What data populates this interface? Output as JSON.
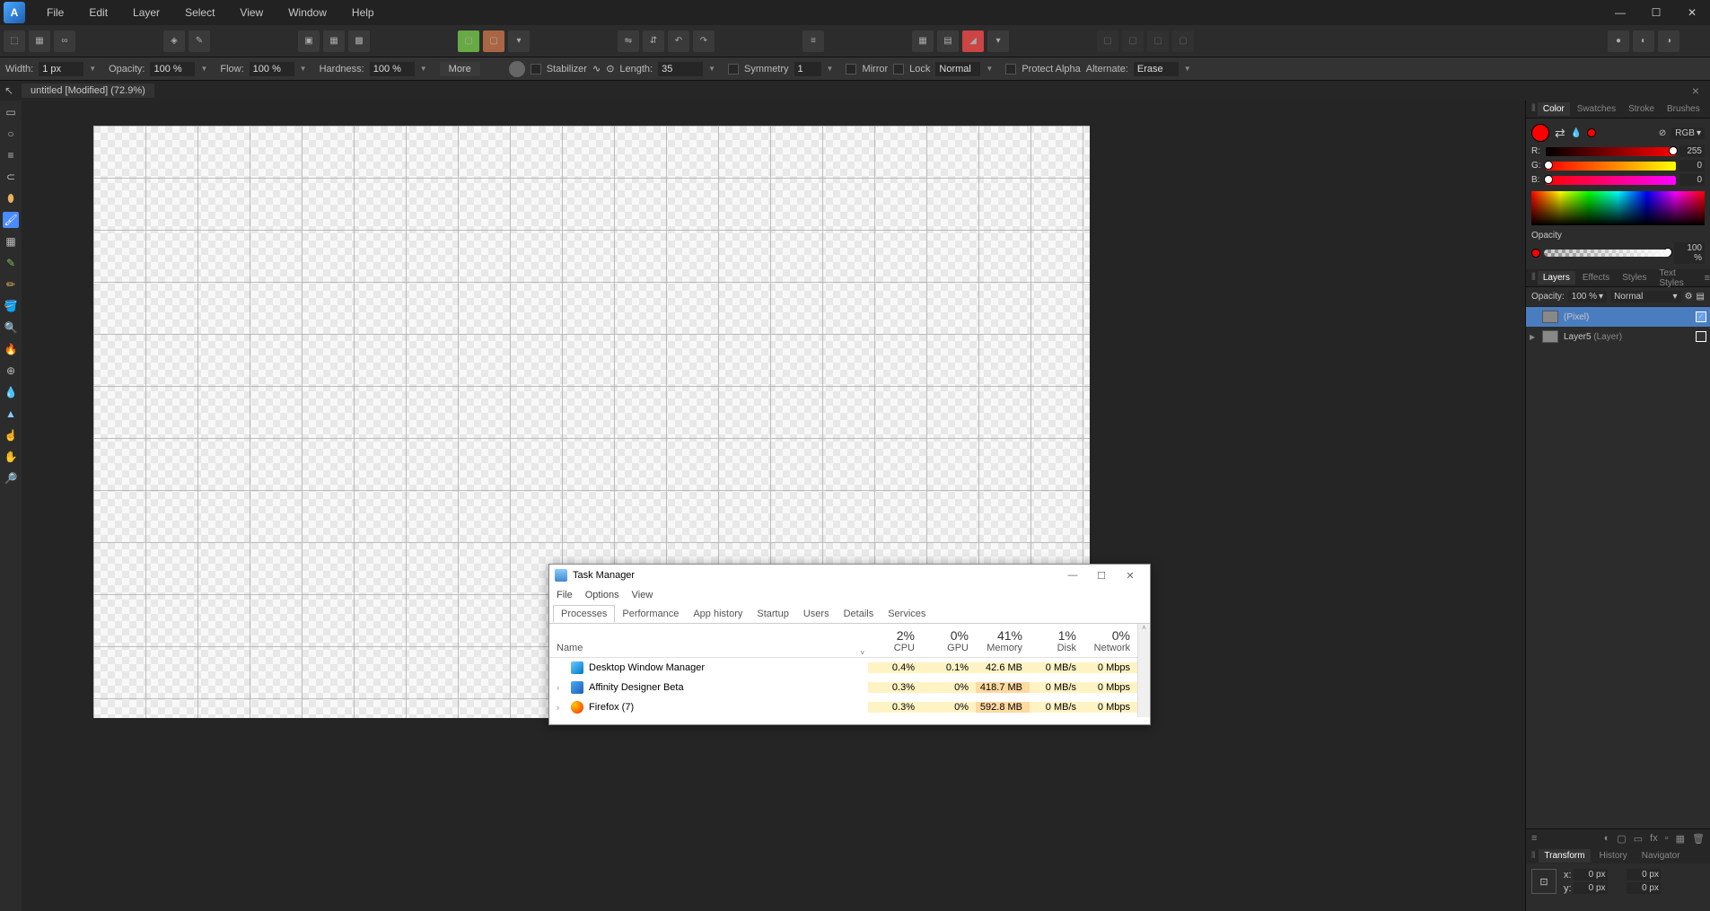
{
  "menu": {
    "items": [
      "File",
      "Edit",
      "Layer",
      "Select",
      "View",
      "Window",
      "Help"
    ]
  },
  "doc": {
    "title": "untitled [Modified] (72.9%)"
  },
  "context": {
    "width_label": "Width:",
    "width_val": "1 px",
    "opacity_label": "Opacity:",
    "opacity_val": "100 %",
    "flow_label": "Flow:",
    "flow_val": "100 %",
    "hardness_label": "Hardness:",
    "hardness_val": "100 %",
    "more": "More",
    "stabilizer": "Stabilizer",
    "length_label": "Length:",
    "length_val": "35",
    "symmetry": "Symmetry",
    "symmetry_val": "1",
    "mirror": "Mirror",
    "lock": "Lock",
    "blend": "Normal",
    "protect": "Protect Alpha",
    "alternate": "Alternate:",
    "alternate_val": "Erase"
  },
  "colorPanel": {
    "tabs": [
      "Color",
      "Swatches",
      "Stroke",
      "Brushes"
    ],
    "mode": "RGB",
    "r": {
      "label": "R:",
      "val": "255"
    },
    "g": {
      "label": "G:",
      "val": "0"
    },
    "b": {
      "label": "B:",
      "val": "0"
    },
    "opacity_label": "Opacity",
    "opacity_val": "100 %"
  },
  "layersPanel": {
    "tabs": [
      "Layers",
      "Effects",
      "Styles",
      "Text Styles"
    ],
    "opacity_label": "Opacity:",
    "opacity_val": "100 %",
    "blend": "Normal",
    "items": [
      {
        "name": "(Pixel)",
        "selected": true,
        "checked": true
      },
      {
        "name": "Layer5",
        "suffix": " (Layer)",
        "selected": false,
        "checked": false
      }
    ]
  },
  "bottomPanel": {
    "tabs": [
      "Transform",
      "History",
      "Navigator"
    ],
    "x_label": "x:",
    "x_val": "0 px",
    "y_label": "y:",
    "y_val": "0 px",
    "w_val": "0 px",
    "h_val": "0 px"
  },
  "taskmgr": {
    "title": "Task Manager",
    "menu": [
      "File",
      "Options",
      "View"
    ],
    "tabs": [
      "Processes",
      "Performance",
      "App history",
      "Startup",
      "Users",
      "Details",
      "Services"
    ],
    "headers": {
      "name": "Name",
      "cpu": {
        "pct": "2%",
        "label": "CPU"
      },
      "gpu": {
        "pct": "0%",
        "label": "GPU"
      },
      "mem": {
        "pct": "41%",
        "label": "Memory"
      },
      "disk": {
        "pct": "1%",
        "label": "Disk"
      },
      "net": {
        "pct": "0%",
        "label": "Network"
      }
    },
    "rows": [
      {
        "name": "Desktop Window Manager",
        "icon": "dwm",
        "cpu": "0.4%",
        "gpu": "0.1%",
        "mem": "42.6 MB",
        "disk": "0 MB/s",
        "net": "0 Mbps",
        "expand": false
      },
      {
        "name": "Affinity Designer Beta",
        "icon": "aff",
        "cpu": "0.3%",
        "gpu": "0%",
        "mem": "418.7 MB",
        "disk": "0 MB/s",
        "net": "0 Mbps",
        "expand": true,
        "mem_hl": true
      },
      {
        "name": "Firefox (7)",
        "icon": "ff",
        "cpu": "0.3%",
        "gpu": "0%",
        "mem": "592.8 MB",
        "disk": "0 MB/s",
        "net": "0 Mbps",
        "expand": true,
        "mem_hl": true
      }
    ]
  }
}
